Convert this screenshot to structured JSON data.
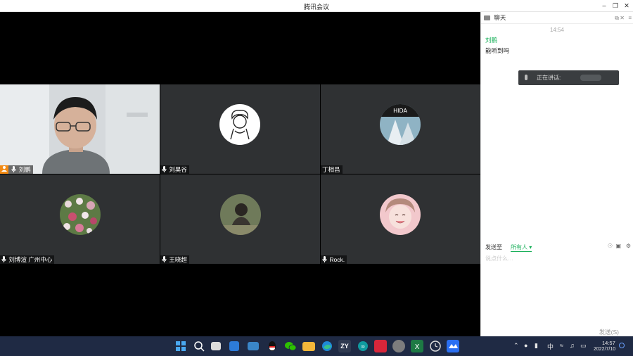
{
  "window": {
    "title": "腾讯会议",
    "controls": [
      "minimize",
      "restore",
      "close"
    ]
  },
  "participants": [
    {
      "name": "刘鹏",
      "host": true,
      "avatar": "camera-video",
      "muted": false
    },
    {
      "name": "刘昊谷",
      "host": false,
      "avatar": "cartoon-avatar",
      "muted": false
    },
    {
      "name": "丁相昌",
      "host": false,
      "avatar": "photo-avatar",
      "muted": false
    },
    {
      "name": "刘博渲 广州中心",
      "host": false,
      "avatar": "flowers-avatar",
      "muted": false
    },
    {
      "name": "王晓超",
      "host": false,
      "avatar": "person-avatar",
      "muted": false
    },
    {
      "name": "Rock.",
      "host": false,
      "avatar": "anime-avatar",
      "muted": false
    }
  ],
  "chat": {
    "title": "聊天",
    "time": "14:54",
    "sender": "刘鹏",
    "message": "能听到吗",
    "audio_label": "正在讲话:",
    "scope_label": "发送至",
    "recipient": "所有人",
    "input_placeholder": "说点什么…",
    "send_label": "发送(S)"
  },
  "taskbar": {
    "clock_time": "14:57",
    "clock_date": "2022/7/10",
    "ime": "中",
    "tray_icons": [
      "chevron-up-icon",
      "qq-icon",
      "mic-icon",
      "ime-icon",
      "wifi-icon",
      "volume-icon",
      "battery-icon",
      "notification-icon"
    ],
    "apps": [
      "windows-start-icon",
      "search-icon",
      "task-view-icon",
      "widgets-icon",
      "desktop-icon",
      "qq-icon",
      "wechat-icon",
      "file-explorer-icon",
      "edge-icon",
      "zy-icon",
      "arduino-icon",
      "app-red-icon",
      "player-icon",
      "excel-icon",
      "clock-icon",
      "tencent-meeting-icon"
    ]
  },
  "colors": {
    "tile_bg": "#2f3133",
    "accent_green": "#19b05a",
    "host_orange": "#f28a14",
    "taskbar": "#1f2a44"
  }
}
